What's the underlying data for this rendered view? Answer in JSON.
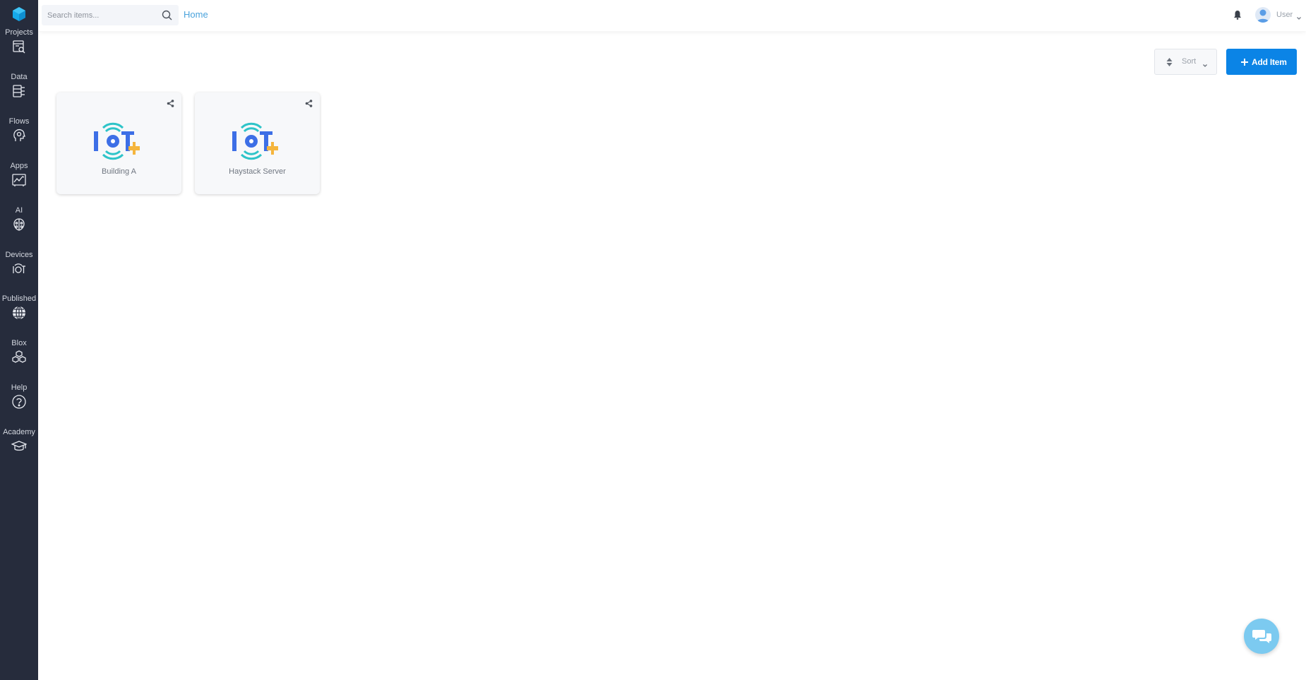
{
  "sidebar": {
    "logo_icon": "cube-logo-icon",
    "items": [
      {
        "label": "Projects",
        "icon": "projects-icon"
      },
      {
        "label": "Data",
        "icon": "data-icon"
      },
      {
        "label": "Flows",
        "icon": "flows-head-icon"
      },
      {
        "label": "Apps",
        "icon": "apps-chart-icon"
      },
      {
        "label": "AI",
        "icon": "ai-brain-icon"
      },
      {
        "label": "Devices",
        "icon": "iot-icon"
      },
      {
        "label": "Published",
        "icon": "globe-icon"
      },
      {
        "label": "Blox",
        "icon": "blox-cubes-icon"
      },
      {
        "label": "Help",
        "icon": "help-icon"
      },
      {
        "label": "Academy",
        "icon": "graduation-cap-icon"
      }
    ]
  },
  "header": {
    "search_placeholder": "Search items...",
    "breadcrumb": "Home",
    "user_label": "User"
  },
  "toolbar": {
    "sort_label": "Sort",
    "add_label": "Add Item"
  },
  "items": [
    {
      "label": "Building A",
      "icon": "iot-device-icon"
    },
    {
      "label": "Haystack Server",
      "icon": "iot-device-icon"
    }
  ],
  "colors": {
    "sidebar_bg": "#262c3c",
    "accent": "#0b84e6",
    "link": "#4aa3dc",
    "chat": "#7ccaf0"
  }
}
